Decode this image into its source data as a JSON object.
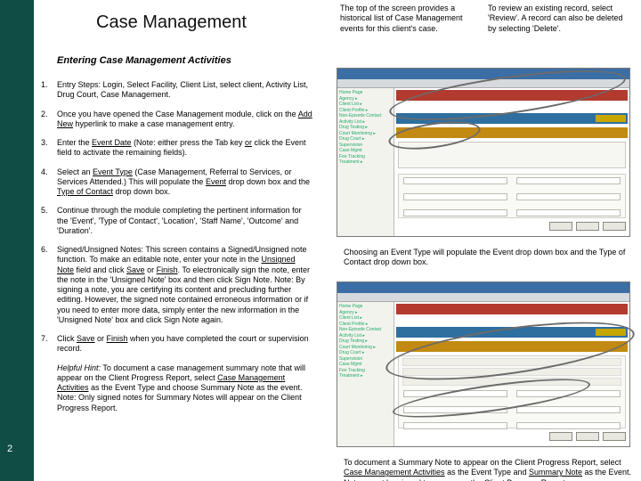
{
  "page": {
    "number": "2"
  },
  "header": {
    "title": "Case Management",
    "subtitle": "Entering Case Management Activities"
  },
  "steps": [
    {
      "n": "1.",
      "html": "Entry Steps: Login, Select Facility, Client List, select client, Activity List, Drug Court, Case Management."
    },
    {
      "n": "2.",
      "html": "Once you have opened the Case Management module, click on the <span class='ul'>Add New</span> hyperlink to make a case management entry."
    },
    {
      "n": "3.",
      "html": "Enter the <span class='ul'>Event Date</span> (Note: either press the Tab key <span class='ul'>or</span> click the Event field to activate the remaining fields)."
    },
    {
      "n": "4.",
      "html": "Select an <span class='ul'>Event Type</span> (Case Management, Referral to Services, or Services Attended.)  This will populate the <span class='ul'>Event</span> drop down box and the <span class='ul'>Type of Contact</span> drop down box."
    },
    {
      "n": "5.",
      "html": "Continue through the module completing the pertinent information for the 'Event', 'Type of Contact', 'Location', 'Staff Name', 'Outcome' and 'Duration'."
    },
    {
      "n": "6.",
      "html": "Signed/Unsigned Notes: This screen contains a Signed/Unsigned note function. To make an editable note, enter your note in the <span class='ul'>Unsigned Note</span> field and click <span class='ul'>Save</span> or <span class='ul'>Finish</span>. To electronically sign the note, enter the note in the 'Unsigned Note' box and then click Sign Note. Note: By signing a note, you are certifying its content and precluding further editing. However, the signed note contained erroneous information or if you need to enter more data, simply enter the new information in the 'Unsigned Note' box and click Sign Note again."
    },
    {
      "n": "7.",
      "html": "Click <span class='ul'>Save</span> or <span class='ul'>Finish</span> when you have completed the court or supervision record."
    },
    {
      "n": "",
      "html": "<span class='i'>Helpful Hint:</span> To document a case management summary note that will appear on the Client Progress Report, select <span class='ul'>Case Management Activities</span> as the Event Type and choose Summary Note as the event. Note: Only signed notes for Summary Notes will appear on the Client Progress Report."
    }
  ],
  "callouts": {
    "top_left": "The top of the screen provides a historical list of Case Management events for this client's case.",
    "top_right": "To review an existing record, select 'Review'. A record can also be deleted by selecting 'Delete'.",
    "mid": "Choosing an Event Type will populate the Event drop down box and the Type of Contact drop down box.",
    "bot": "To document a Summary Note to appear on the Client Progress Report, select <span class='ul'>Case Management Activities</span> as the Event Type and <span class='ul'>Summary Note</span> as the Event. Notes must be signed to appear on the Client Progress Report."
  },
  "nav_items": [
    "Home Page",
    "Agency ▸",
    "Client List ▸",
    "Client Profile ▸",
    "Non-Episode Contact",
    "Activity List ▸",
    "Drug Testing ▸",
    "Court Monitoring ▸",
    "Drug Court ▸",
    "Supervision",
    "Case Mgmt",
    "Fee Tracking",
    "Treatment ▸"
  ]
}
